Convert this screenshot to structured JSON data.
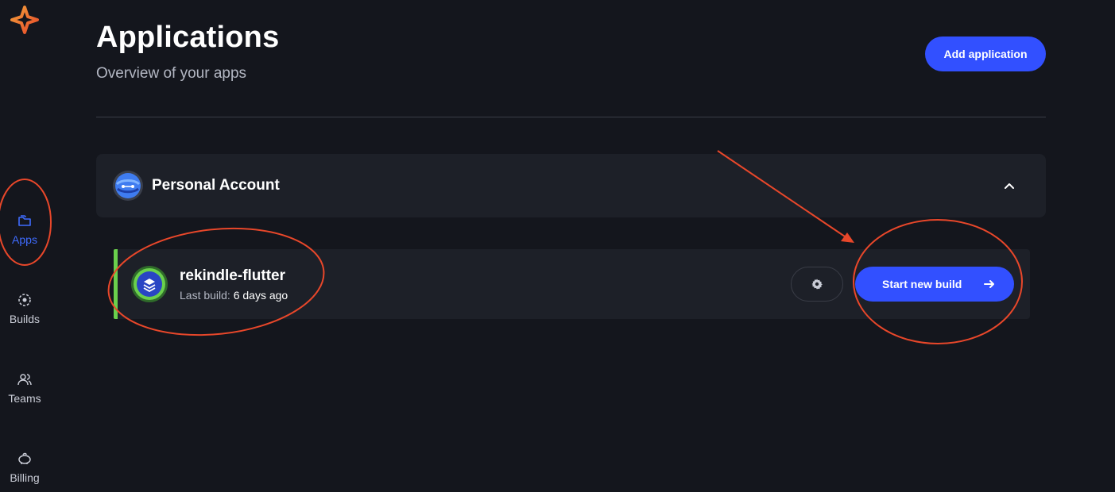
{
  "sidebar": {
    "items": [
      {
        "label": "Apps",
        "icon": "folder-icon",
        "active": true
      },
      {
        "label": "Builds",
        "icon": "builds-icon"
      },
      {
        "label": "Teams",
        "icon": "users-icon"
      },
      {
        "label": "Billing",
        "icon": "piggy-bank-icon"
      }
    ]
  },
  "header": {
    "title": "Applications",
    "subtitle": "Overview of your apps",
    "add_button": "Add application"
  },
  "account": {
    "name": "Personal Account"
  },
  "apps": [
    {
      "name": "rekindle-flutter",
      "last_build_label": "Last build:",
      "last_build_value": "6 days ago",
      "start_build_label": "Start new build"
    }
  ],
  "colors": {
    "background": "#14161d",
    "card": "#1d2028",
    "accent": "#3250ff",
    "active_nav": "#3f6cff",
    "status_green": "#6ad04c",
    "annotation": "#e8472a"
  }
}
